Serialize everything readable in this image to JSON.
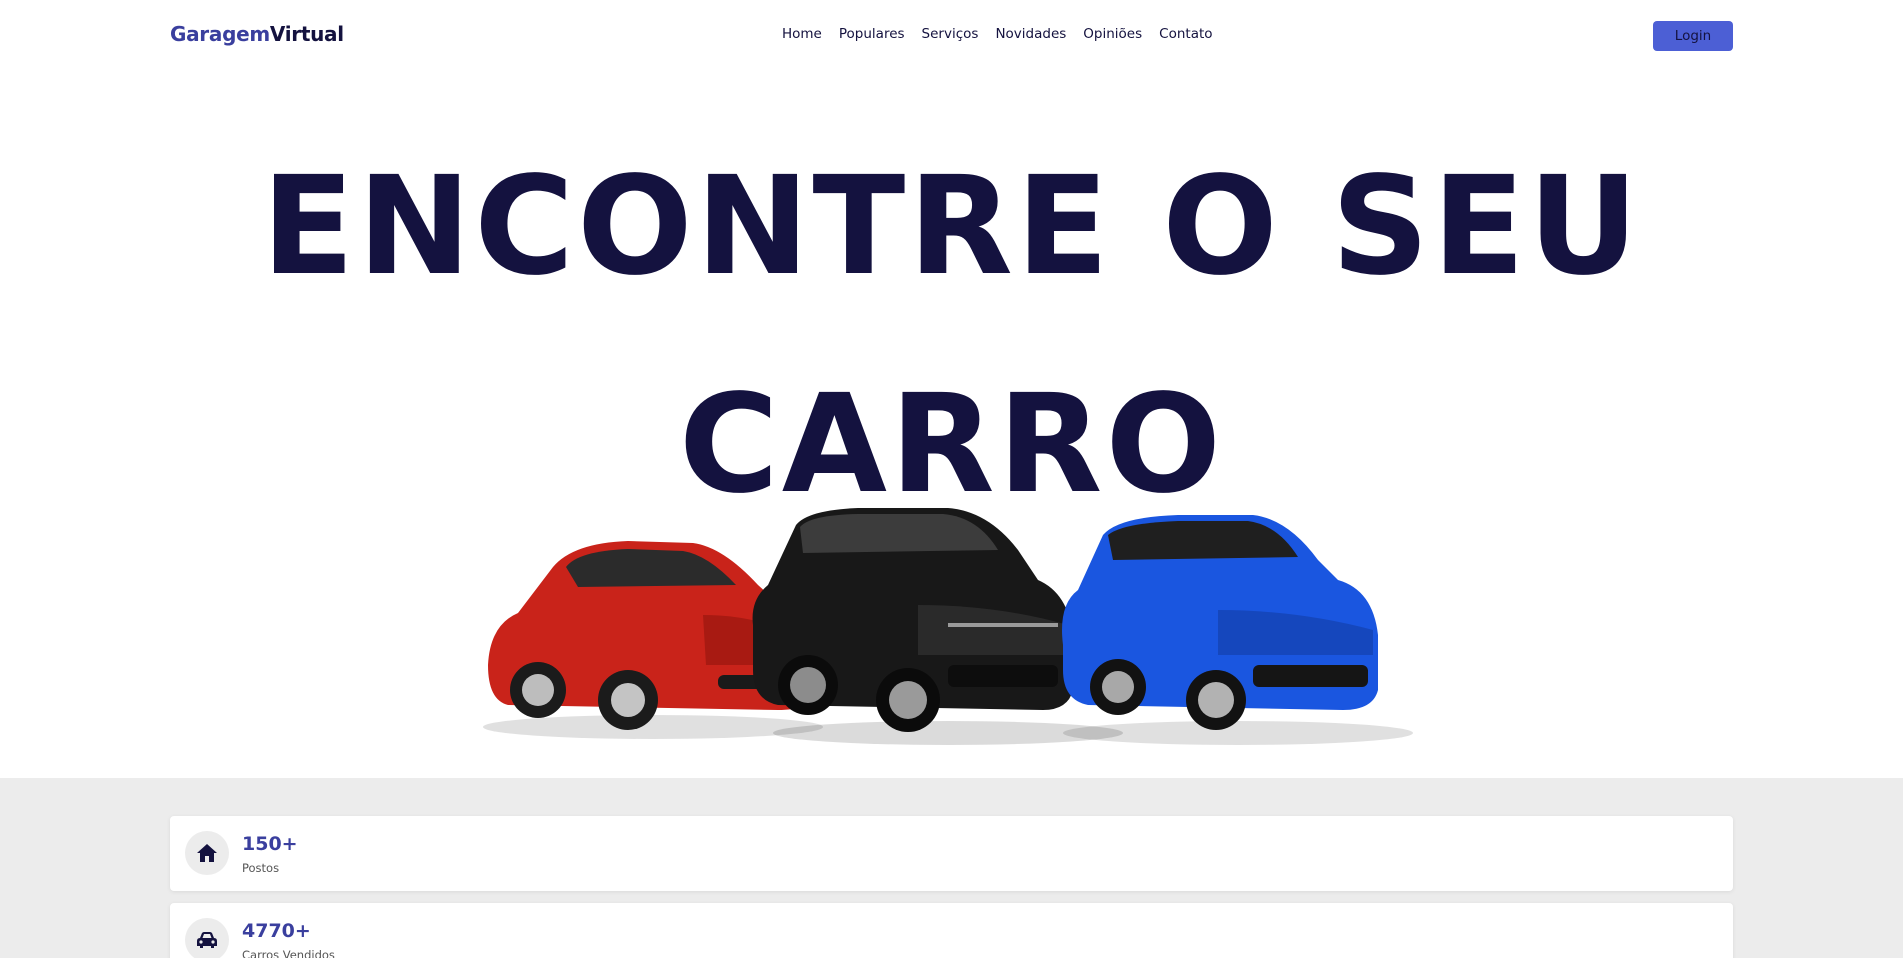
{
  "header": {
    "logo_part1": "Garagem",
    "logo_part2": "Virtual",
    "menu": [
      "Home",
      "Populares",
      "Serviços",
      "Novidades",
      "Opiniões",
      "Contato"
    ],
    "login_label": "Login"
  },
  "hero": {
    "title_line1": "ENCONTRE O SEU",
    "title_line2": "CARRO"
  },
  "stats": [
    {
      "icon": "home-icon",
      "value": "150+",
      "label": "Postos"
    },
    {
      "icon": "car-icon",
      "value": "4770+",
      "label": "Carros Vendidos"
    }
  ],
  "colors": {
    "brand": "#3a3f9e",
    "navy": "#14123f",
    "button": "#4c5fd5",
    "band": "#ececec"
  }
}
